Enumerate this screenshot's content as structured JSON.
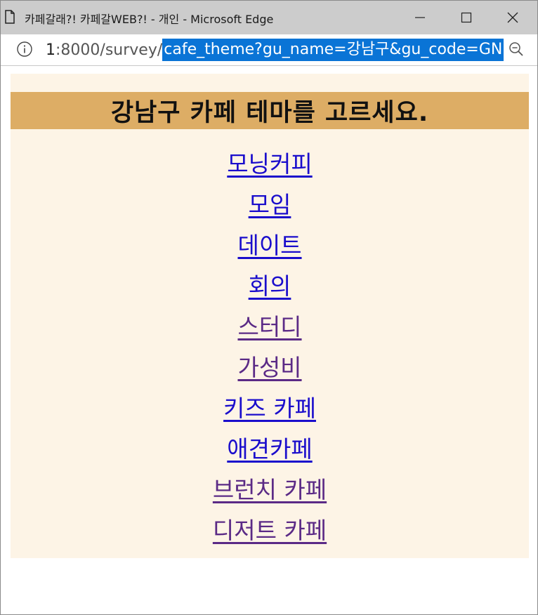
{
  "window": {
    "title": "카페갈래?! 카페갈WEB?! - 개인 - Microsoft Edge"
  },
  "addressbar": {
    "url_prefix_dark": "1",
    "url_prefix": ":8000/survey/",
    "url_selected": "cafe_theme?gu_name=강남구&gu_code=GN"
  },
  "page": {
    "heading": "강남구 카페 테마를 고르세요.",
    "themes": [
      {
        "label": "모닝커피",
        "visited": false
      },
      {
        "label": "모임",
        "visited": false
      },
      {
        "label": "데이트",
        "visited": false
      },
      {
        "label": "회의",
        "visited": false
      },
      {
        "label": "스터디",
        "visited": true
      },
      {
        "label": "가성비",
        "visited": true
      },
      {
        "label": "키즈 카페",
        "visited": false
      },
      {
        "label": "애견카페",
        "visited": false
      },
      {
        "label": "브런치 카페",
        "visited": true
      },
      {
        "label": "디저트 카페",
        "visited": true
      }
    ]
  },
  "colors": {
    "heading_bg": "#ddad65",
    "content_bg": "#fdf4e6",
    "link": "#1a0dcc",
    "link_visited": "#5b2a86",
    "selection": "#0a74d6"
  },
  "icons": {
    "page": "page-icon",
    "info": "info-icon",
    "zoom": "zoom-out-icon",
    "minimize": "minimize-icon",
    "maximize": "maximize-icon",
    "close": "close-icon"
  }
}
